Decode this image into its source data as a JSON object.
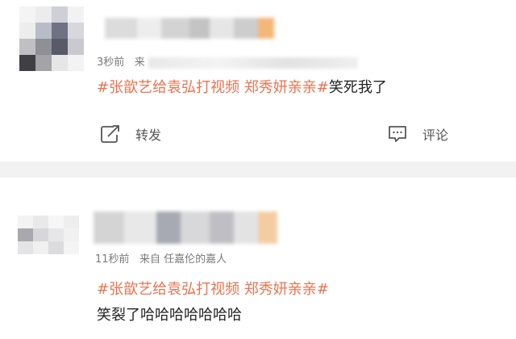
{
  "posts": [
    {
      "time": "3秒前",
      "source_prefix": "来",
      "hashtags": "#张歆艺给袁弘打视频 郑秀妍亲亲#",
      "text": "笑死我了",
      "actions": {
        "repost": "转发",
        "comment": "评论"
      }
    },
    {
      "time": "11秒前",
      "source": "来自 任嘉伦的嘉人",
      "hashtags": "#张歆艺给袁弘打视频 郑秀妍亲亲#",
      "text": "笑裂了哈哈哈哈哈哈哈"
    }
  ],
  "colors": {
    "hashtag": "#eb7350",
    "separator": "#f2f2f2",
    "meta_text": "#7a7a7a"
  },
  "icons": {
    "repost": "repost-icon",
    "comment": "comment-icon"
  }
}
